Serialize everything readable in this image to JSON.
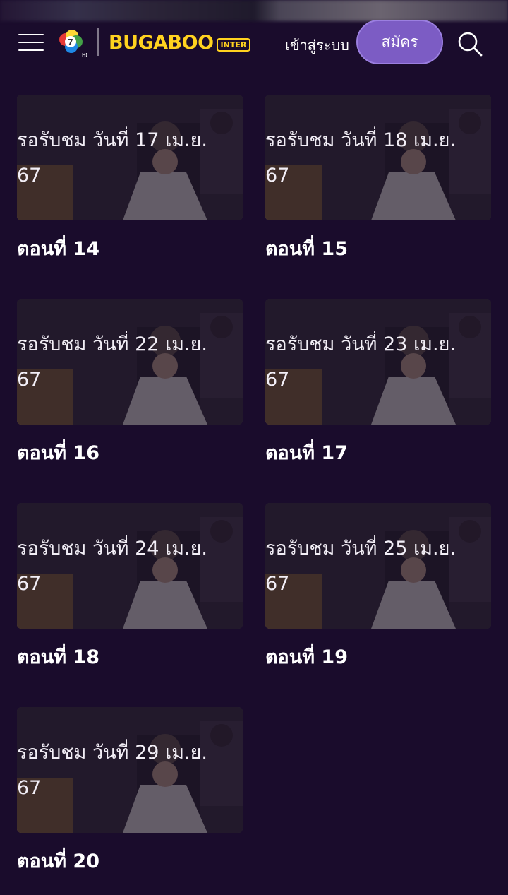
{
  "header": {
    "channel_logo": "ch7-hd-logo",
    "brand_name": "BUGABOO",
    "brand_badge": "INTER",
    "login_label": "เข้าสู่ระบบ",
    "signup_label": "สมัคร",
    "search_icon": "search-icon",
    "menu_icon": "hamburger-menu-icon"
  },
  "episodes": [
    {
      "status": "รอรับชม วันที่ 17 เม.ย. 67",
      "title": "ตอนที่ 14"
    },
    {
      "status": "รอรับชม วันที่ 18 เม.ย. 67",
      "title": "ตอนที่ 15"
    },
    {
      "status": "รอรับชม วันที่ 22 เม.ย. 67",
      "title": "ตอนที่ 16"
    },
    {
      "status": "รอรับชม วันที่ 23 เม.ย. 67",
      "title": "ตอนที่ 17"
    },
    {
      "status": "รอรับชม วันที่ 24 เม.ย. 67",
      "title": "ตอนที่ 18"
    },
    {
      "status": "รอรับชม วันที่ 25 เม.ย. 67",
      "title": "ตอนที่ 19"
    },
    {
      "status": "รอรับชม วันที่ 29 เม.ย. 67",
      "title": "ตอนที่ 20"
    }
  ],
  "colors": {
    "background": "#1a0c2c",
    "accent": "#7c5cc4",
    "brand": "#ffd21f"
  }
}
